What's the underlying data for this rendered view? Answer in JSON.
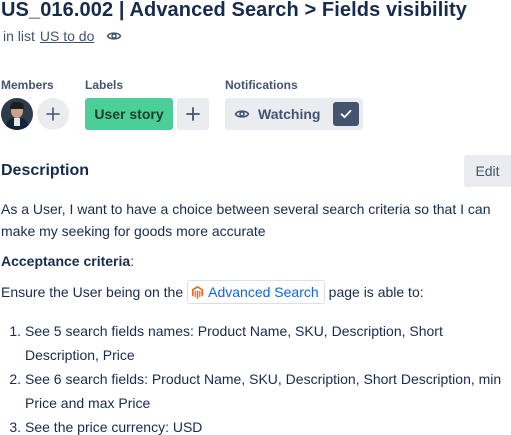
{
  "card": {
    "title": "US_016.002 | Advanced Search > Fields visibility",
    "in_list_prefix": "in list",
    "list_name": "US to do"
  },
  "members": {
    "label": "Members"
  },
  "labels": {
    "label": "Labels",
    "items": [
      "User story"
    ]
  },
  "notifications": {
    "label": "Notifications",
    "watch_label": "Watching"
  },
  "description": {
    "heading": "Description",
    "edit_label": "Edit",
    "intro": "As a User, I want to have a choice between several search criteria so that I can make my seeking for goods more accurate",
    "criteria_heading": "Acceptance criteria",
    "criteria_colon": ":",
    "ensure_before": "Ensure the User being on the",
    "link_text": "Advanced Search",
    "ensure_after": "page is able to:",
    "items": [
      {
        "num": "1.",
        "text": "See 5 search fields names: Product Name, SKU, Description, Short Description, Price"
      },
      {
        "num": "2.",
        "text": "See 6 search fields: Product Name, SKU, Description, Short Description, min Price and max Price"
      },
      {
        "num": "3.",
        "text": "See the price currency: USD"
      }
    ]
  },
  "colors": {
    "label_green": "#4bce97",
    "button_gray": "#ebecf0",
    "link_blue": "#0c66e4",
    "magento_orange": "#f26322"
  },
  "icons": [
    "eye-icon",
    "plus-icon",
    "check-icon",
    "magento-logo-icon"
  ]
}
